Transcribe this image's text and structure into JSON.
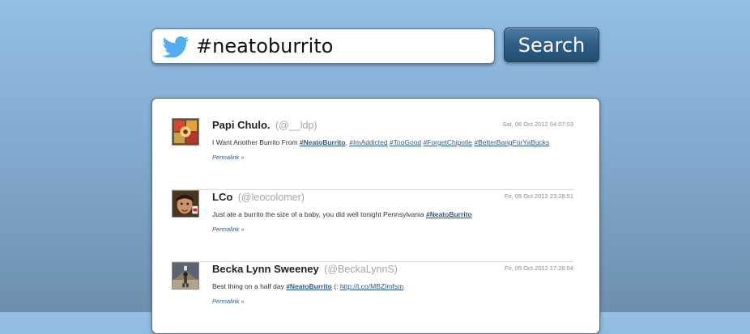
{
  "search": {
    "query": "#neatoburrito",
    "button_label": "Search"
  },
  "colors": {
    "bird": "#55acee",
    "button": "#2f5c84",
    "link": "#2b5a87"
  },
  "tweets": [
    {
      "name": "Papi Chulo.",
      "handle": "(@__ldp)",
      "timestamp": "Sat, 06 Oct 2012 04:07:03",
      "avatar_icon": "avatar-colorful-pattern",
      "text_before": "I Want Another Burrito From ",
      "links": [
        "#NeatoBurrito",
        "#ImAddicted",
        "#TooGood",
        "#ForgetChipotle",
        "#BetterBangForYaBucks"
      ],
      "permalink": "Permalink »"
    },
    {
      "name": "LCo",
      "handle": "(@leocolomer)",
      "timestamp": "Fri, 05 Oct 2012 23:28:51",
      "avatar_icon": "avatar-face-photo",
      "text_before": "Just ate a burrito the size of a baby, you did well tonight Pennsylvania ",
      "links": [
        "#NeatoBurrito"
      ],
      "permalink": "Permalink »"
    },
    {
      "name": "Becka Lynn Sweeney",
      "handle": "(@BeckaLynnS)",
      "timestamp": "Fri, 05 Oct 2012 17:26:04",
      "avatar_icon": "avatar-bowling-photo",
      "text_before": "Best thing on a half day ",
      "links": [
        "#NeatoBurrito"
      ],
      "text_between": " (: ",
      "url": "http://t.co/MBZImfsm",
      "permalink": "Permalink »"
    }
  ]
}
